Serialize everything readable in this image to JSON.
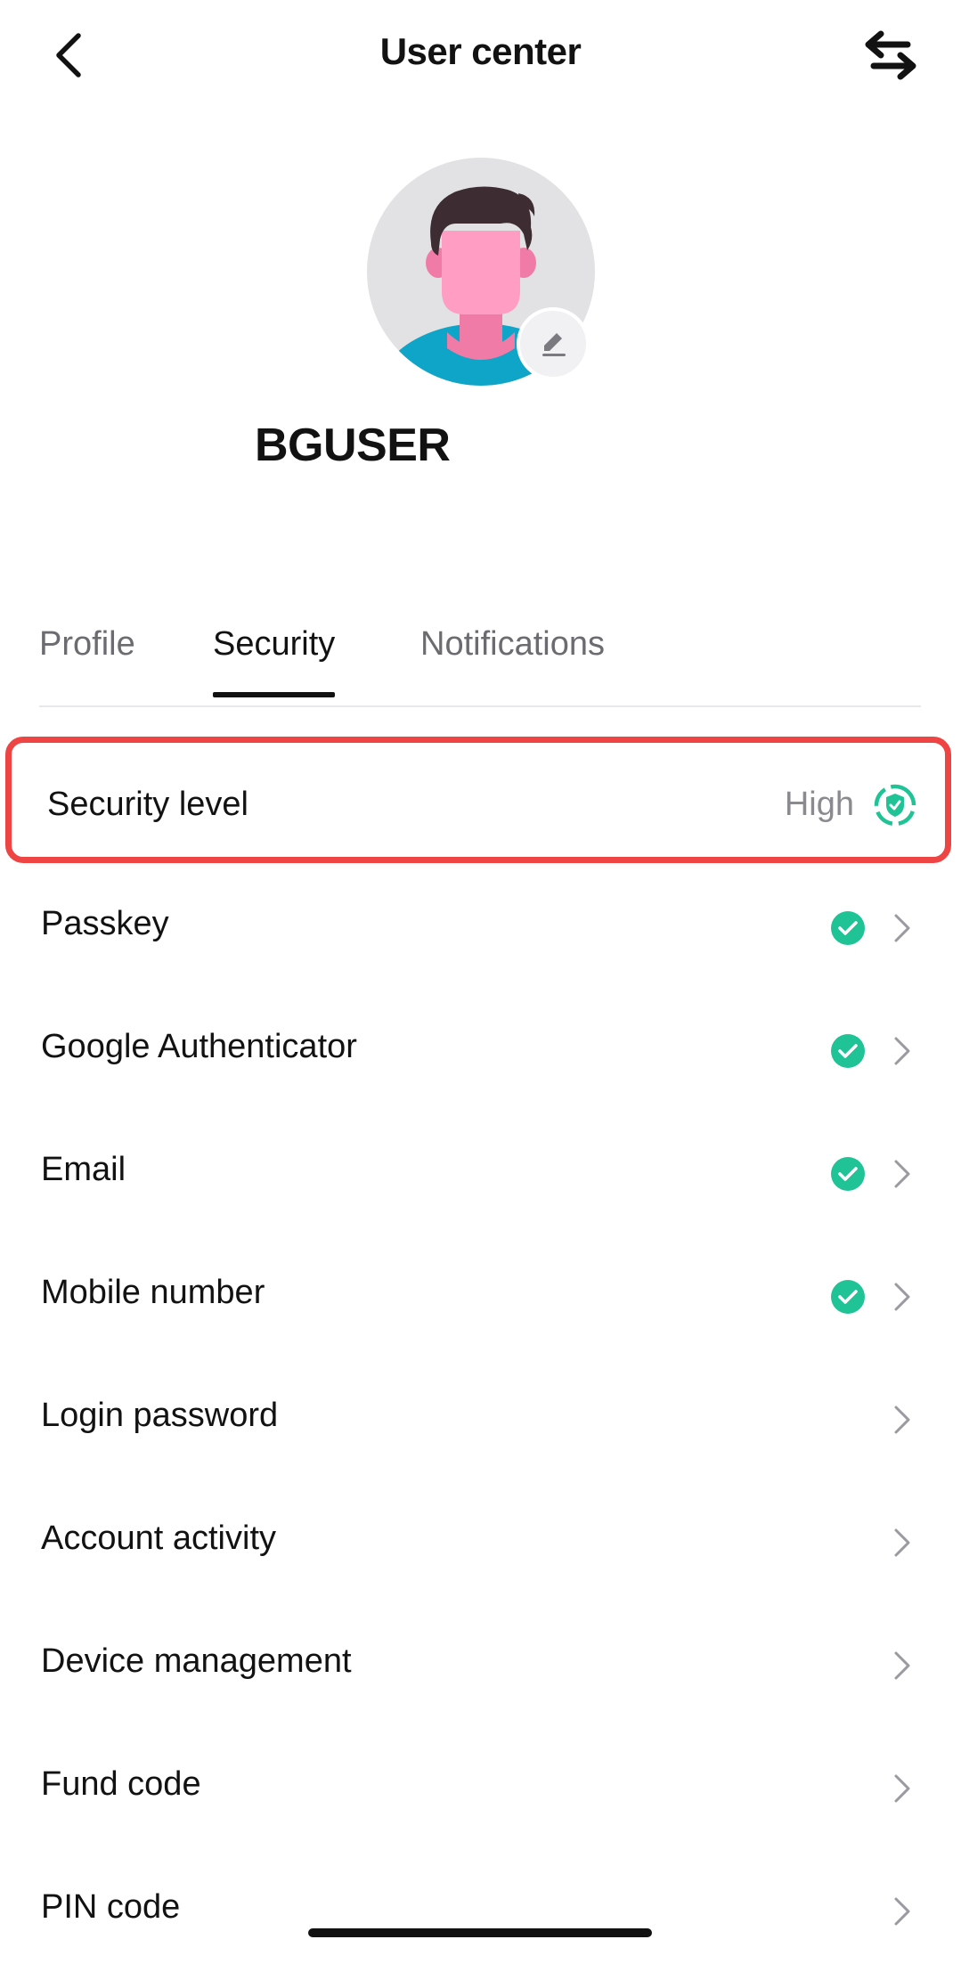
{
  "header": {
    "title": "User center",
    "back_icon": "chevron-left-icon",
    "switch_icon": "swap-arrows-icon"
  },
  "profile": {
    "username": "BGUSER",
    "avatar_icon": "default-avatar",
    "edit_icon": "pencil-icon"
  },
  "tabs": [
    {
      "label": "Profile",
      "active": false
    },
    {
      "label": "Security",
      "active": true
    },
    {
      "label": "Notifications",
      "active": false
    }
  ],
  "security_level": {
    "label": "Security level",
    "value": "High",
    "icon": "shield-check-icon",
    "highlight_color": "#ee4444"
  },
  "items": [
    {
      "label": "Passkey",
      "verified": true
    },
    {
      "label": "Google Authenticator",
      "verified": true
    },
    {
      "label": "Email",
      "verified": true
    },
    {
      "label": "Mobile number",
      "verified": true
    },
    {
      "label": "Login password",
      "verified": false
    },
    {
      "label": "Account activity",
      "verified": false
    },
    {
      "label": "Device management",
      "verified": false
    },
    {
      "label": "Fund code",
      "verified": false
    },
    {
      "label": "PIN code",
      "verified": false
    }
  ],
  "colors": {
    "accent_green": "#1fc395",
    "text_primary": "#121212",
    "text_secondary": "#8a8a8f"
  }
}
